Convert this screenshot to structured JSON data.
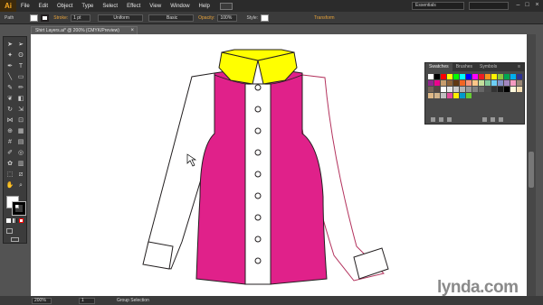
{
  "app": {
    "logo": "Ai"
  },
  "menu": [
    "File",
    "Edit",
    "Object",
    "Type",
    "Select",
    "Effect",
    "View",
    "Window",
    "Help"
  ],
  "workspace": "Essentials",
  "control_bar": {
    "selection_type": "Path",
    "stroke_label": "Stroke:",
    "stroke_weight": "1 pt",
    "profile_label": "Uniform",
    "brush_label": "Basic",
    "opacity_label": "Opacity:",
    "opacity_value": "100%",
    "style_label": "Style:",
    "transform_label": "Transform"
  },
  "document_tab": {
    "title": "Shirt Layers.ai* @ 200% (CMYK/Preview)",
    "close": "×"
  },
  "panel": {
    "tabs": [
      "Swatches",
      "Brushes",
      "Symbols"
    ],
    "swatch_colors": [
      "#ffffff",
      "#000000",
      "#ff0000",
      "#ffff00",
      "#00ff00",
      "#00ffff",
      "#0000ff",
      "#ff00ff",
      "#ed1c24",
      "#f7941d",
      "#fff200",
      "#8dc63f",
      "#00a651",
      "#00aeef",
      "#2e3192",
      "#92278f",
      "#ec008c",
      "#c69c6d",
      "#8c6239",
      "#603913",
      "#f26522",
      "#f7977a",
      "#fdc689",
      "#c4df9b",
      "#82ca9c",
      "#6dcff6",
      "#8393ca",
      "#a186be",
      "#f49ac1",
      "#998675",
      "#736357",
      "#534741",
      "#ffffff",
      "#e6e6e6",
      "#cccccc",
      "#b3b3b3",
      "#999999",
      "#808080",
      "#666666",
      "#4d4d4d",
      "#333333",
      "#1a1a1a",
      "#000000",
      "#fff8dc",
      "#f5deb3",
      "#deb887",
      "#d2b48c",
      "#c0c0c0",
      "#e24b9b",
      "#ffee00",
      "#0099cc",
      "#66cc33"
    ]
  },
  "status": {
    "zoom": "200%",
    "page": "1",
    "tool": "Group Selection"
  },
  "watermark": "lynda.com",
  "colors": {
    "shirt_body": "#e0218a",
    "collar": "#ffff00",
    "sleeve": "#ffffff",
    "outline": "#231f20"
  }
}
